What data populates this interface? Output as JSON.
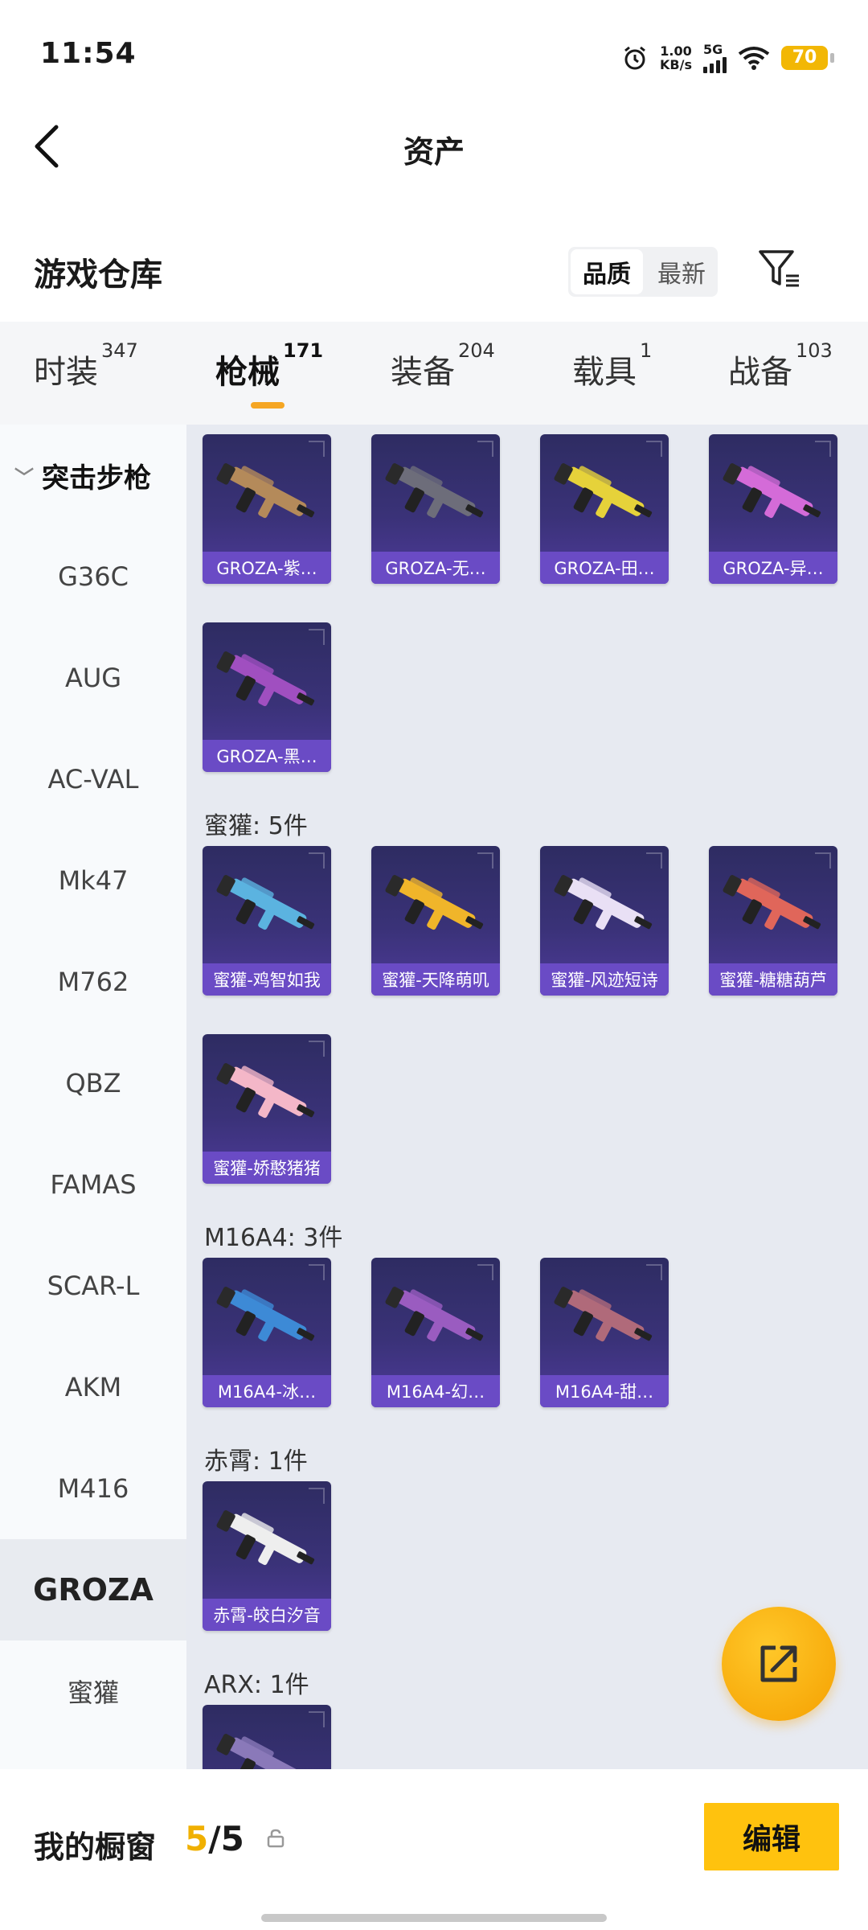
{
  "status_bar": {
    "time": "11:54",
    "net_speed_value": "1.00",
    "net_speed_unit": "KB/s",
    "signal": "5G",
    "battery": "70"
  },
  "header": {
    "title": "资产"
  },
  "section": {
    "title": "游戏仓库",
    "sort_options": [
      "品质",
      "最新"
    ],
    "sort_selected": "品质"
  },
  "tabs": [
    {
      "label": "时装",
      "count": "347"
    },
    {
      "label": "枪械",
      "count": "171",
      "active": true
    },
    {
      "label": "装备",
      "count": "204"
    },
    {
      "label": "载具",
      "count": "1"
    },
    {
      "label": "战备",
      "count": "103"
    }
  ],
  "sidenav": {
    "category": "突击步枪",
    "items": [
      "G36C",
      "AUG",
      "AC-VAL",
      "Mk47",
      "M762",
      "QBZ",
      "FAMAS",
      "SCAR-L",
      "AKM",
      "M416",
      "GROZA",
      "蜜獾"
    ],
    "selected": "GROZA"
  },
  "groups": [
    {
      "label": "",
      "items": [
        {
          "name": "GROZA-紫…",
          "tint": "#b48a5a"
        },
        {
          "name": "GROZA-无…",
          "tint": "#6d6d7a"
        },
        {
          "name": "GROZA-田…",
          "tint": "#e6d23a"
        },
        {
          "name": "GROZA-异…",
          "tint": "#d46bd8"
        },
        {
          "name": "GROZA-黑…",
          "tint": "#a04fc0"
        }
      ]
    },
    {
      "label": "蜜獾: 5件",
      "items": [
        {
          "name": "蜜獾-鸡智如我",
          "tint": "#5bb3e0"
        },
        {
          "name": "蜜獾-天降萌叽",
          "tint": "#f0b52a"
        },
        {
          "name": "蜜獾-风迹短诗",
          "tint": "#e9e0f5"
        },
        {
          "name": "蜜獾-糖糖葫芦",
          "tint": "#e0665a"
        },
        {
          "name": "蜜獾-娇憨猪猪",
          "tint": "#f4b7c8"
        }
      ]
    },
    {
      "label": "M16A4: 3件",
      "items": [
        {
          "name": "M16A4-冰…",
          "tint": "#3d8ad6"
        },
        {
          "name": "M16A4-幻…",
          "tint": "#9a5cc0"
        },
        {
          "name": "M16A4-甜…",
          "tint": "#b06a7a"
        }
      ]
    },
    {
      "label": "赤霄: 1件",
      "items": [
        {
          "name": "赤霄-皎白汐音",
          "tint": "#eeeeee"
        }
      ]
    },
    {
      "label": "ARX: 1件",
      "items": [
        {
          "name": "",
          "tint": "#8a79b9"
        }
      ]
    }
  ],
  "bottom_bar": {
    "label": "我的橱窗",
    "current": "5",
    "separator": "/",
    "total": "5",
    "edit_label": "编辑"
  },
  "colors": {
    "accent": "#ffc20e",
    "card_label": "#6a4bc5",
    "tab_underline": "#f5a623"
  }
}
